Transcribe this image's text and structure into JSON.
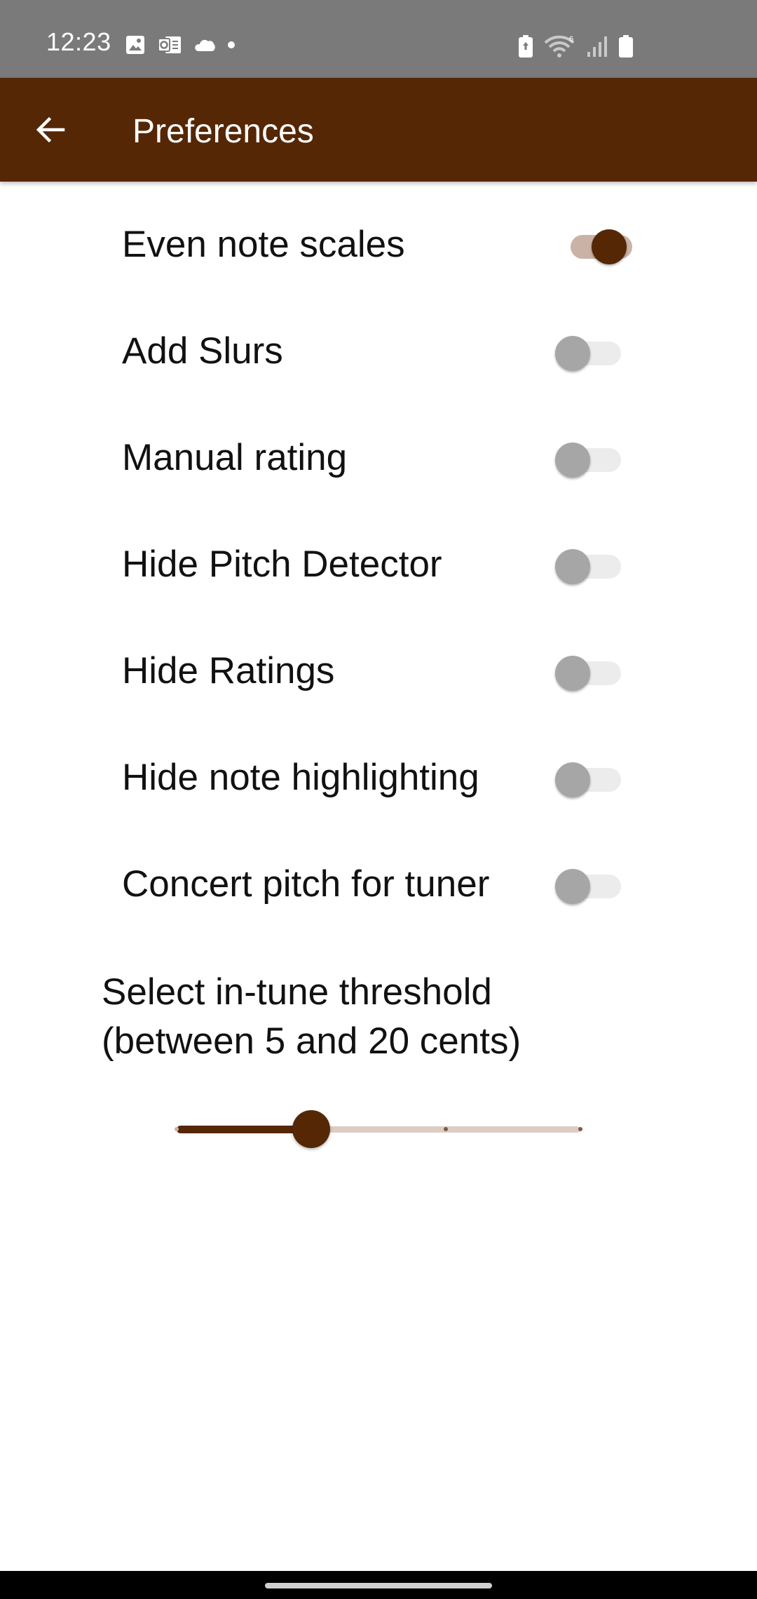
{
  "status_bar": {
    "time": "12:23",
    "background_color": "#7a7a7a",
    "left_icons": [
      "image-icon",
      "outlook-icon",
      "cloud-icon",
      "dot-icon"
    ],
    "right_icons": [
      "battery-saver-icon",
      "wifi-icon",
      "signal-icon",
      "battery-icon"
    ]
  },
  "app_bar": {
    "title": "Preferences",
    "back_icon": "arrow-back-icon",
    "background_color": "#552705"
  },
  "preferences": [
    {
      "label": "Even note scales",
      "enabled": true
    },
    {
      "label": "Add Slurs",
      "enabled": false
    },
    {
      "label": "Manual rating",
      "enabled": false
    },
    {
      "label": "Hide Pitch Detector",
      "enabled": false
    },
    {
      "label": "Hide Ratings",
      "enabled": false
    },
    {
      "label": "Hide note highlighting",
      "enabled": false
    },
    {
      "label": "Concert pitch for tuner",
      "enabled": false
    }
  ],
  "threshold": {
    "label_line1": "Select in-tune threshold",
    "label_line2": "(between 5 and 20 cents)",
    "min": 5,
    "max": 20,
    "step": 5,
    "value": 10
  },
  "colors": {
    "accent": "#552705",
    "accent_light": "#cbb2a6",
    "switch_off_thumb": "#a6a6a6",
    "switch_off_track": "#ececec"
  }
}
